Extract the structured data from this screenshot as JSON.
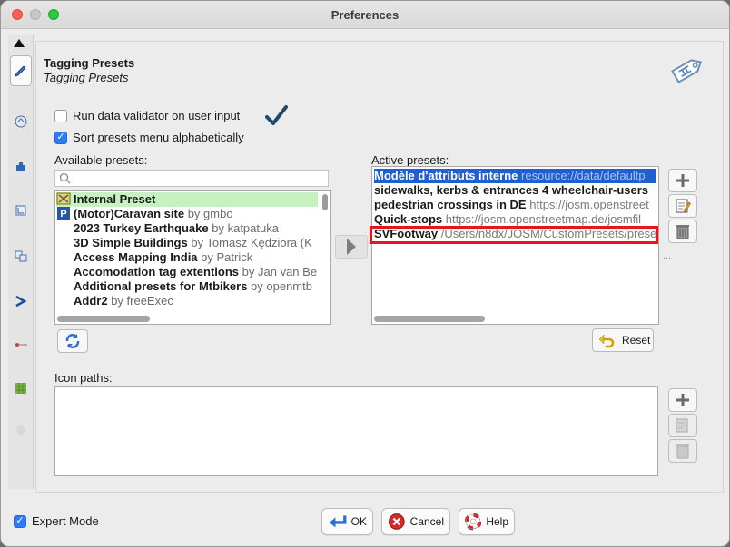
{
  "window": {
    "title": "Preferences"
  },
  "tabs": [
    {
      "icon": "scroll-up-icon"
    },
    {
      "icon": "tagging-presets-icon",
      "active": true
    },
    {
      "icon": "map-projection-icon"
    },
    {
      "icon": "plugin-icon"
    },
    {
      "icon": "map-settings-icon"
    },
    {
      "icon": "remote-control-icon"
    },
    {
      "icon": "shortcuts-icon"
    },
    {
      "icon": "display-icon"
    },
    {
      "icon": "imagery-icon"
    }
  ],
  "header": {
    "title": "Tagging Presets",
    "subtitle": "Tagging Presets"
  },
  "options": {
    "validator_label": "Run data validator on user input",
    "validator_checked": false,
    "sort_label": "Sort presets menu alphabetically",
    "sort_checked": true
  },
  "available": {
    "label": "Available presets:",
    "search_placeholder": "",
    "items": [
      {
        "name": "Internal Preset",
        "author": ""
      },
      {
        "name": "(Motor)Caravan site",
        "author": "by gmbo"
      },
      {
        "name": "2023 Turkey Earthquake",
        "author": "by katpatuka"
      },
      {
        "name": "3D Simple Buildings",
        "author": "by Tomasz Kędziora (K"
      },
      {
        "name": "Access Mapping India",
        "author": "by Patrick"
      },
      {
        "name": "Accomodation tag extentions",
        "author": "by Jan van Be"
      },
      {
        "name": "Additional presets for Mtbikers",
        "author": "by openmtb"
      },
      {
        "name": "Addr2",
        "author": "by freeExec"
      }
    ]
  },
  "active": {
    "label": "Active presets:",
    "items": [
      {
        "name": "Modèle d'attributs interne",
        "url": "resource://data/defaultp"
      },
      {
        "name": "sidewalks, kerbs & entrances 4 wheelchair-users",
        "url": ""
      },
      {
        "name": "pedestrian crossings in DE",
        "url": "https://josm.openstreet"
      },
      {
        "name": "Quick-stops",
        "url": "https://josm.openstreetmap.de/josmfil"
      },
      {
        "name": "SVFootway",
        "url": "/Users/n8dx/JOSM/CustomPresets/prese"
      }
    ],
    "ellipsis": "..."
  },
  "buttons": {
    "reset": "Reset",
    "ok": "OK",
    "cancel": "Cancel",
    "help": "Help"
  },
  "icon_paths": {
    "label": "Icon paths:"
  },
  "expert": {
    "label": "Expert Mode",
    "checked": true
  },
  "colors": {
    "selection": "#1f5fcf",
    "internal_preset_bg": "#c6f1c0",
    "highlight_box": "#e8141e"
  }
}
